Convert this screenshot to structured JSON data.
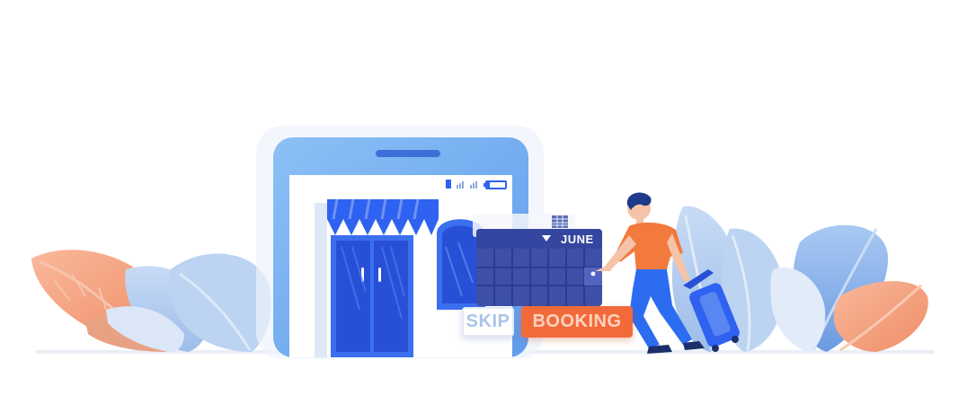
{
  "calendar": {
    "month": "JUNE"
  },
  "actions": {
    "skip_label": "SKIP",
    "booking_label": "BOOKING"
  },
  "colors": {
    "phone_frame": "#7fb6f2",
    "store_blue": "#2f62f0",
    "calendar_bg": "#3d4fa8",
    "booking_orange": "#f36a3a",
    "person_shirt": "#f27a3c",
    "person_pants": "#2c6cf0",
    "leaf_orange": "#f4a98a",
    "leaf_blue": "#a8c7ef"
  },
  "icons": [
    "signal-bars-icon",
    "battery-icon",
    "calendar-grid-icon",
    "dropdown-arrow-icon",
    "luggage-icon"
  ]
}
